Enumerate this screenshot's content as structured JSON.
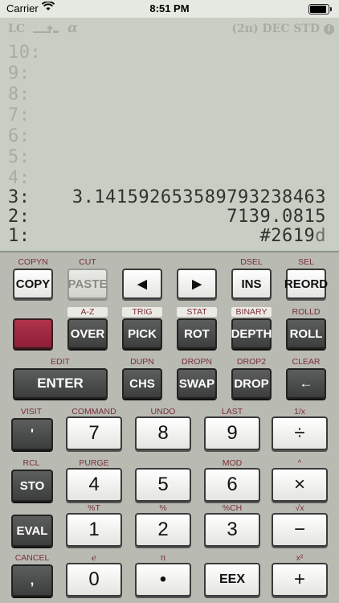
{
  "status": {
    "carrier": "Carrier",
    "time": "8:51 PM"
  },
  "lcd": {
    "annunciators": {
      "lc": "LC",
      "alpha": "α",
      "mode": "(2π) DEC STD",
      "info": "i"
    },
    "stack": [
      {
        "level": "10:",
        "value": ""
      },
      {
        "level": "9:",
        "value": ""
      },
      {
        "level": "8:",
        "value": ""
      },
      {
        "level": "7:",
        "value": ""
      },
      {
        "level": "6:",
        "value": ""
      },
      {
        "level": "5:",
        "value": ""
      },
      {
        "level": "4:",
        "value": ""
      },
      {
        "level": "3:",
        "value": "3.14159265358979323846З"
      },
      {
        "level": "2:",
        "value": "7139.0815"
      },
      {
        "level": "1:",
        "value": "#2619",
        "unit": "d"
      }
    ]
  },
  "rows": {
    "r1": [
      {
        "top": "COPYN",
        "label": "COPY"
      },
      {
        "top": "CUT",
        "label": "PASTE"
      },
      {
        "top": "",
        "label": "◀"
      },
      {
        "top": "",
        "label": "▶"
      },
      {
        "top": "DSEL",
        "label": "INS"
      },
      {
        "top": "SEL",
        "label": "REORD"
      }
    ],
    "r2": [
      {
        "top": "",
        "label": ""
      },
      {
        "top": "A-Z",
        "label": "OVER"
      },
      {
        "top": "TRIG",
        "label": "PICK"
      },
      {
        "top": "STAT",
        "label": "ROT"
      },
      {
        "top": "BINARY",
        "label": "DEPTH"
      },
      {
        "top": "ROLLD",
        "label": "ROLL"
      }
    ],
    "r3": [
      {
        "top": "EDIT",
        "label": "ENTER"
      },
      {
        "top": "DUPN",
        "label": "CHS"
      },
      {
        "top": "DROPN",
        "label": "SWAP"
      },
      {
        "top": "DROP2",
        "label": "DROP"
      },
      {
        "top": "CLEAR",
        "label": "←"
      }
    ],
    "r4": [
      {
        "top": "VISIT",
        "label": "'"
      },
      {
        "top": "COMMAND",
        "label": "7"
      },
      {
        "top": "UNDO",
        "label": "8"
      },
      {
        "top": "LAST",
        "label": "9"
      },
      {
        "top": "1/x",
        "label": "÷"
      }
    ],
    "r5": [
      {
        "top": "RCL",
        "label": "STO"
      },
      {
        "top": "PURGE",
        "label": "4"
      },
      {
        "top": "",
        "label": "5"
      },
      {
        "top": "MOD",
        "label": "6"
      },
      {
        "top": "^",
        "label": "×"
      }
    ],
    "r6": [
      {
        "top": "",
        "label": "EVAL"
      },
      {
        "top": "%T",
        "label": "1"
      },
      {
        "top": "%",
        "label": "2"
      },
      {
        "top": "%CH",
        "label": "3"
      },
      {
        "top": "√x",
        "label": "−"
      }
    ],
    "r7": [
      {
        "top": "CANCEL",
        "label": ","
      },
      {
        "top": "e",
        "label": "0"
      },
      {
        "top": "π",
        "label": "•"
      },
      {
        "top": "",
        "label": "EEX"
      },
      {
        "top": "x²",
        "label": "+"
      }
    ]
  }
}
